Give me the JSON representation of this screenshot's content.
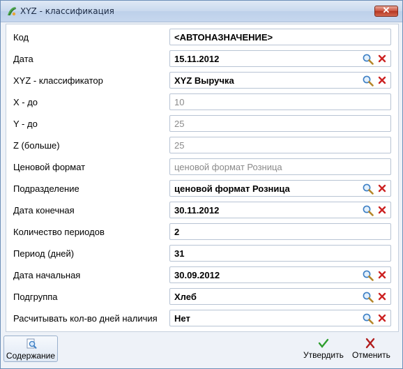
{
  "window": {
    "title": "XYZ - классификация",
    "close_glyph": "✕"
  },
  "fields": [
    {
      "label": "Код",
      "value": "<АВТОНАЗНАЧЕНИЕ>",
      "style": "bold",
      "lookup": false
    },
    {
      "label": "Дата",
      "value": "15.11.2012",
      "style": "bold",
      "lookup": true
    },
    {
      "label": "XYZ - классификатор",
      "value": "XYZ Выручка",
      "style": "bold",
      "lookup": true
    },
    {
      "label": "X - до",
      "value": "10",
      "style": "muted",
      "lookup": false
    },
    {
      "label": "Y - до",
      "value": "25",
      "style": "muted",
      "lookup": false
    },
    {
      "label": "Z (больше)",
      "value": "25",
      "style": "muted",
      "lookup": false
    },
    {
      "label": "Ценовой формат",
      "value": "ценовой формат Розница",
      "style": "muted",
      "lookup": false
    },
    {
      "label": "Подразделение",
      "value": "ценовой формат Розница",
      "style": "bold",
      "lookup": true
    },
    {
      "label": "Дата конечная",
      "value": "30.11.2012",
      "style": "bold",
      "lookup": true
    },
    {
      "label": "Количество периодов",
      "value": "2",
      "style": "bold",
      "lookup": false
    },
    {
      "label": "Период (дней)",
      "value": "31",
      "style": "bold",
      "lookup": false
    },
    {
      "label": "Дата начальная",
      "value": "30.09.2012",
      "style": "bold",
      "lookup": true
    },
    {
      "label": "Подгруппа",
      "value": "Хлеб",
      "style": "bold",
      "lookup": true
    },
    {
      "label": "Расчитывать кол-во дней наличия",
      "value": "Нет",
      "style": "bold",
      "lookup": true
    }
  ],
  "footer": {
    "content_label": "Содержание",
    "approve_label": "Утвердить",
    "cancel_label": "Отменить"
  },
  "colors": {
    "search_icon": "#3d7fc4",
    "clear_icon": "#cc2222",
    "approve_icon": "#2e9e2e"
  },
  "icons": {
    "search": "search-icon",
    "clear": "clear-icon",
    "approve": "checkmark-icon",
    "cancel": "cross-icon",
    "content": "magnifier-doc-icon"
  }
}
